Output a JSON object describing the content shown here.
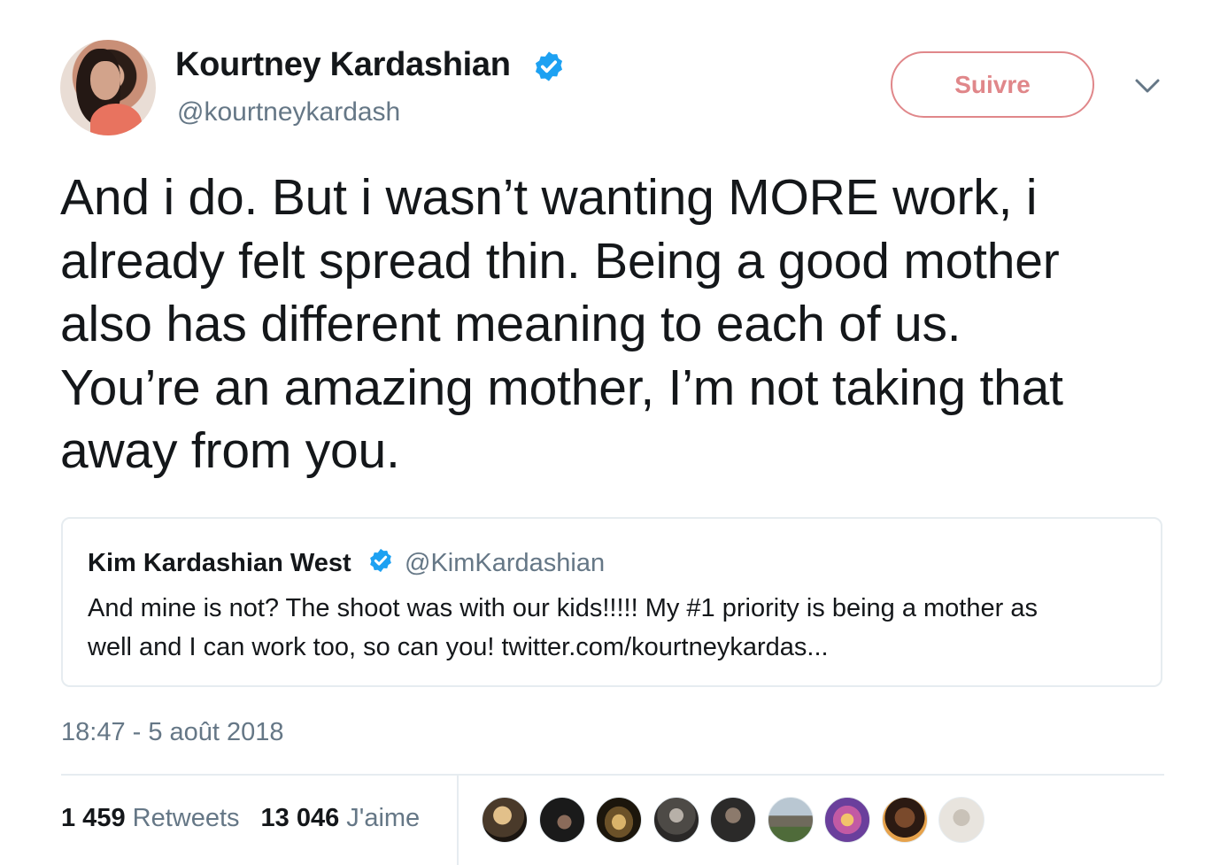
{
  "author": {
    "name": "Kourtney Kardashian",
    "handle": "@kourtneykardash",
    "verified": true
  },
  "follow_button": "Suivre",
  "tweet_text": "And i do. But i wasn’t wanting MORE work, i\nalready felt spread thin. Being a good mother\nalso has different meaning to each of us.\nYou’re an amazing mother, I’m not taking that\naway from you.",
  "quoted": {
    "name": "Kim Kardashian West",
    "handle": "@KimKardashian",
    "verified": true,
    "text": "And mine is not? The shoot was with our kids!!!!! My #1 priority is being a mother as\nwell and I can work too, so can you! twitter.com/kourtneykardas..."
  },
  "timestamp": "18:47 - 5 août 2018",
  "stats": {
    "retweets_count": "1 459",
    "retweets_label": "Retweets",
    "likes_count": "13 046",
    "likes_label": "J'aime"
  },
  "liker_avatars": 9,
  "colors": {
    "follow_accent": "#e0878a",
    "verified_blue": "#1da1f2",
    "secondary_text": "#657786"
  }
}
